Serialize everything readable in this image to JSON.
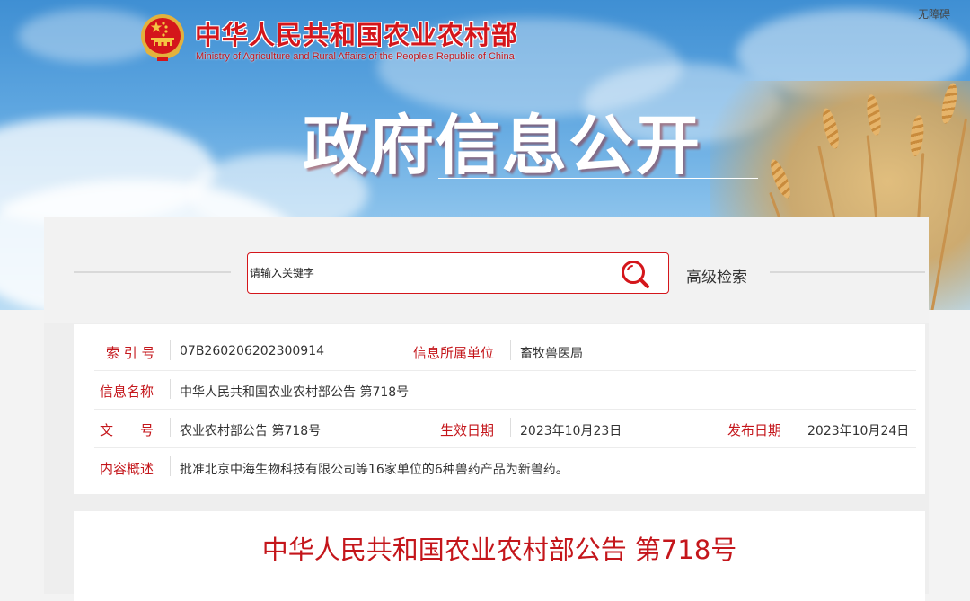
{
  "header": {
    "ministry_cn": "中华人民共和国农业农村部",
    "ministry_en": "Ministry of Agriculture and Rural Affairs of the People's Republic of China",
    "accessibility": "无障碍",
    "page_title": "政府信息公开"
  },
  "search": {
    "placeholder": "请输入关键字",
    "advanced_label": "高级检索",
    "icon": "search-icon"
  },
  "info": {
    "index_label": "索 引 号",
    "index_value": "07B260206202300914",
    "unit_label": "信息所属单位",
    "unit_value": "畜牧兽医局",
    "name_label": "信息名称",
    "name_value": "中华人民共和国农业农村部公告 第718号",
    "doc_label": "文　　号",
    "doc_value": "农业农村部公告 第718号",
    "effective_label": "生效日期",
    "effective_value": "2023年10月23日",
    "publish_label": "发布日期",
    "publish_value": "2023年10月24日",
    "summary_label": "内容概述",
    "summary_value": "批准北京中海生物科技有限公司等16家单位的6种兽药产品为新兽药。"
  },
  "article": {
    "title": "中华人民共和国农业农村部公告 第718号"
  },
  "colors": {
    "accent": "#c4161b",
    "banner_sky": "#5ea6e0",
    "panel_bg": "#eeeeee"
  }
}
